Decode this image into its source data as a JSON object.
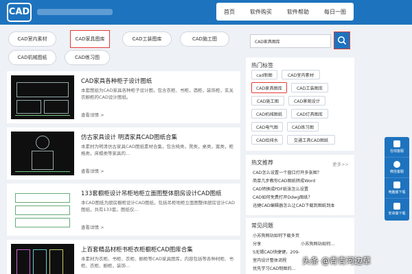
{
  "header": {
    "logo_text": "CAD",
    "nav": [
      "首页",
      "软件购买",
      "软件帮助",
      "每日一图"
    ]
  },
  "category_tags": [
    "CAD室内素材",
    "CAD家具图库",
    "CAD工装图库",
    "CAD施工图",
    "CAD机械图纸",
    "CAD练习图"
  ],
  "search": {
    "value": "CAD家具图库"
  },
  "hot_tags": {
    "title": "热门标签",
    "items": [
      "cad制图",
      "CAD室内素材",
      "CAD家具图库",
      "CAD工装图库",
      "CAD施工图",
      "CAD景观设计",
      "CAD机械图纸",
      "CAD灯具图库",
      "CAD电气图",
      "CAD练习图",
      "CAD给排水",
      "交通工具CAD图纸"
    ]
  },
  "hot_articles": {
    "title": "热文推荐",
    "more": "更多>>",
    "items": [
      "CAD怎么设置一个窗口打开多张图？",
      "简单几步教你CAD图纸转成Word",
      "CAD转换成PDF纸张怎么设置",
      "CAD如何免费打开Ddwg图纸？",
      "迅捷CAD编辑器怎么让CAD下载到图纸到本"
    ]
  },
  "faq": {
    "title": "常见问题",
    "items": [
      "小苏狗网站如何下载多页",
      "分享",
      "小苏狗网站如何...",
      "S无锡CAD快捷键，209-",
      "室内设计整体流程",
      "优先学习CAD制图的..."
    ]
  },
  "articles": [
    {
      "title": "CAD家具各种柜子设计图纸",
      "desc": "本套图纸为CAD家具各种柜子设计图，包含衣柜、书柜，酒柜，装饰柜，玄关衣橱柜的CAD设计图纸。",
      "more": "查看详情 >"
    },
    {
      "title": "仿古家具设计 明清家具CAD图纸合集",
      "desc": "本素材为明清仿古家具CAD图纸素材合集，包含椅类，凳类，桌类，案类，柜格类，床榻类等家具的...",
      "more": "查看详情 >"
    },
    {
      "title": "133套橱柜设计吊柜地柜立面图整体厨房设计CAD图纸",
      "desc": "本CAD图纸为厨房橱柜设计CAD图纸，包括吊柜地柜立面图整体厨房设计CAD图纸，共有133套。图纸仅...",
      "more": "查看详情 >"
    },
    {
      "title": "上百套精品材柜书柜衣柜橱柜CAD图库合集",
      "desc": "本素材为衣柜、书柜、衣柜、橱柜等CAD家具图库，内容包括等各种材柜、书柜、衣柜、橱柜，装饰...",
      "more": ""
    }
  ],
  "side_float": [
    "在线客服",
    "微信客服",
    "电脑版下载",
    "安卓版下载"
  ],
  "watermark": "头条 @青青河边草"
}
